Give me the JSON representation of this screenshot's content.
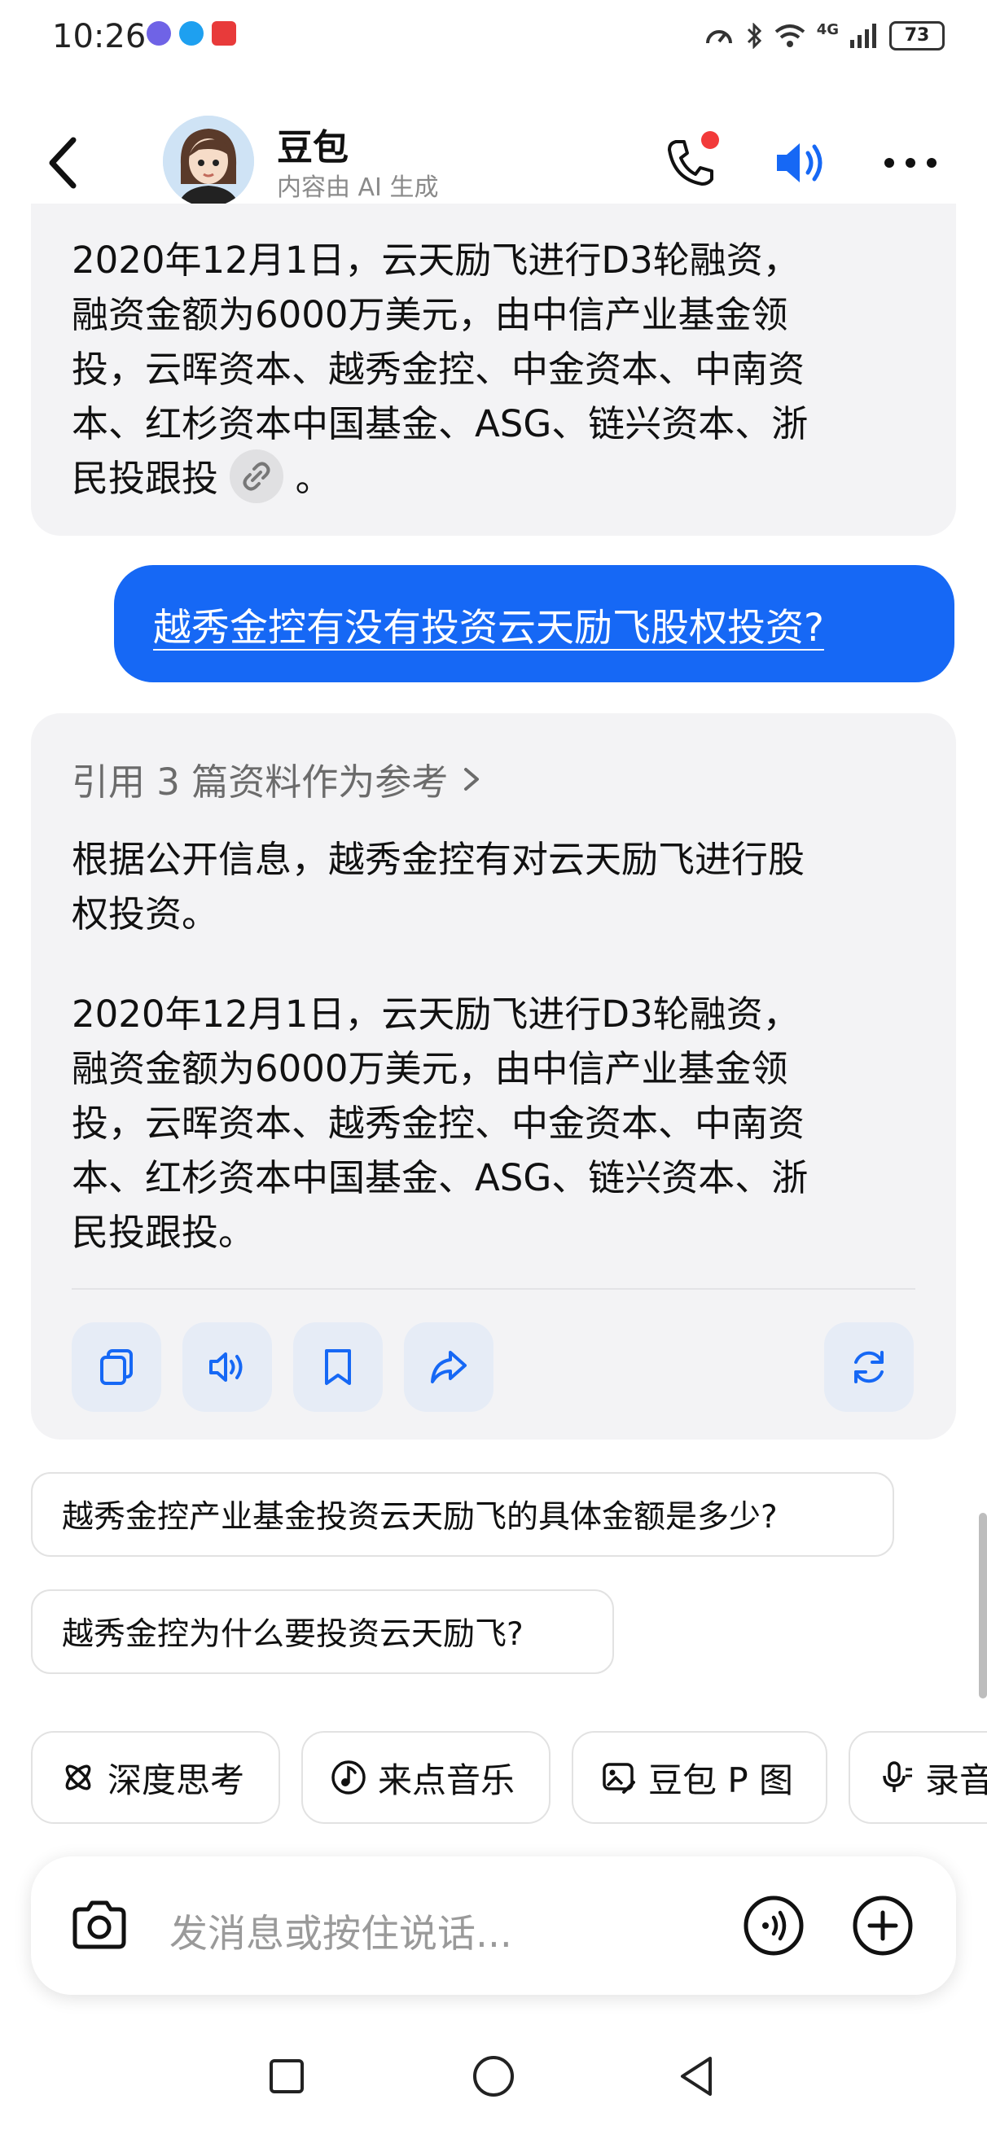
{
  "status_bar": {
    "time": "10:26",
    "network": "4G",
    "battery": "73"
  },
  "header": {
    "title": "豆包",
    "subtitle": "内容由 AI 生成"
  },
  "messages": {
    "ai_prev": {
      "paragraph_lines": [
        "2020年12月1日，云天励飞进行D3轮融资，",
        "融资金额为6000万美元，由中信产业基金领",
        "投，云晖资本、越秀金控、中金资本、中南资",
        "本、红杉资本中国基金、ASG、链兴资本、浙"
      ],
      "last_line": "民投跟投",
      "last_line_end": "。"
    },
    "user": {
      "text": "越秀金控有没有投资云天励飞股权投资?"
    },
    "ai_reply": {
      "reference": "引用 3 篇资料作为参考",
      "p1_lines": [
        "根据公开信息，越秀金控有对云天励飞进行股",
        "权投资。"
      ],
      "p2_lines": [
        "2020年12月1日，云天励飞进行D3轮融资，",
        "融资金额为6000万美元，由中信产业基金领",
        "投，云晖资本、越秀金控、中金资本、中南资",
        "本、红杉资本中国基金、ASG、链兴资本、浙",
        "民投跟投。"
      ]
    }
  },
  "suggestions": [
    "越秀金控产业基金投资云天励飞的具体金额是多少?",
    "越秀金控为什么要投资云天励飞?"
  ],
  "chips": [
    "深度思考",
    "来点音乐",
    "豆包 P 图",
    "录音"
  ],
  "input": {
    "placeholder": "发消息或按住说话..."
  },
  "colors": {
    "accent": "#1668f5",
    "bubble_bg": "#f3f3f5",
    "action_bg": "#e6ecf6",
    "notify_dot": "#f23a3a"
  }
}
